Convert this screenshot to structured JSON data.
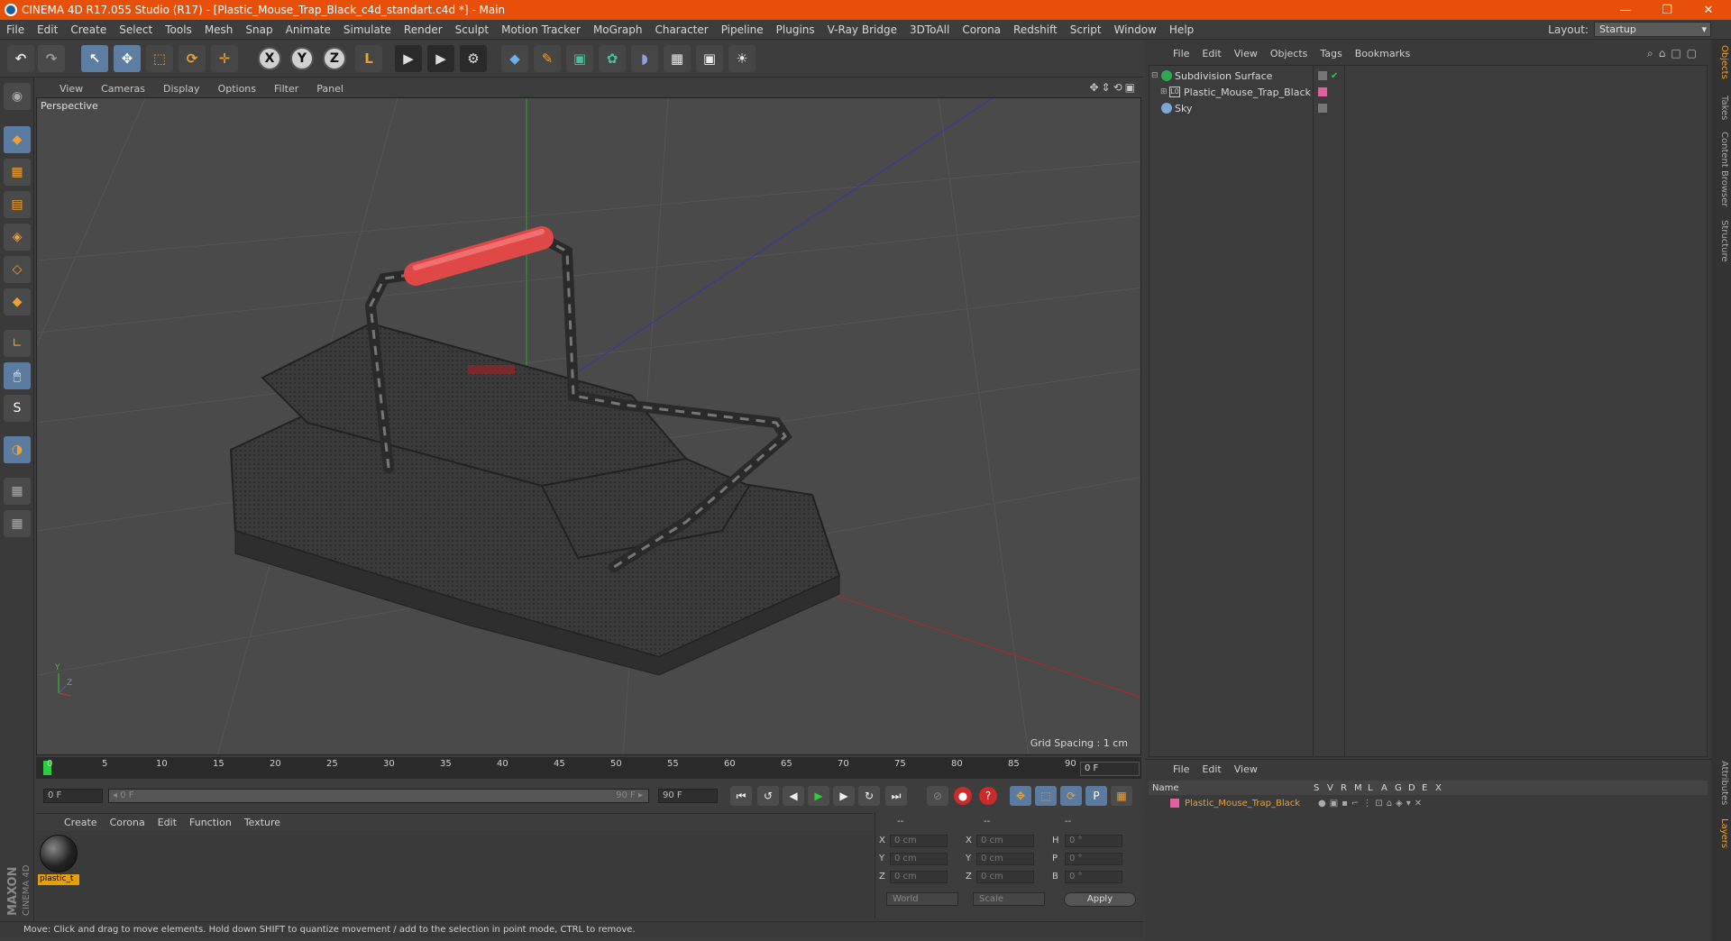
{
  "titlebar": {
    "text": "CINEMA 4D R17.055 Studio (R17) - [Plastic_Mouse_Trap_Black_c4d_standart.c4d *] - Main",
    "min": "—",
    "restore": "❐",
    "close": "✕"
  },
  "menubar": [
    "File",
    "Edit",
    "Create",
    "Select",
    "Tools",
    "Mesh",
    "Snap",
    "Animate",
    "Simulate",
    "Render",
    "Sculpt",
    "Motion Tracker",
    "MoGraph",
    "Character",
    "Pipeline",
    "Plugins",
    "V-Ray Bridge",
    "3DToAll",
    "Corona",
    "Redshift",
    "Script",
    "Window",
    "Help"
  ],
  "layout": {
    "label": "Layout:",
    "value": "Startup"
  },
  "toolbar": {
    "undo": "↶",
    "redo": "↷",
    "select": "↖",
    "move": "✥",
    "scale": "⬚",
    "rotate": "⟳",
    "add": "✛",
    "x": "X",
    "y": "Y",
    "z": "Z",
    "world": "L"
  },
  "viewport": {
    "menu": [
      "View",
      "Cameras",
      "Display",
      "Options",
      "Filter",
      "Panel"
    ],
    "nav_icons": "✥⇕⟲▣",
    "label": "Perspective",
    "grid_spacing": "Grid Spacing : 1 cm"
  },
  "objects": {
    "menu": [
      "File",
      "Edit",
      "View",
      "Objects",
      "Tags",
      "Bookmarks"
    ],
    "items": [
      {
        "name": "Subdivision Surface",
        "icon_color": "#2fa84f"
      },
      {
        "name": "Plastic_Mouse_Trap_Black",
        "icon_color": "#8a8a8a",
        "tag_color": "#e060a0"
      },
      {
        "name": "Sky",
        "icon_color": "#7aa7d6"
      }
    ]
  },
  "side_tabs": [
    "Objects",
    "Takes",
    "Content Browser",
    "Structure",
    "Attributes",
    "Layers"
  ],
  "layers": {
    "menu": [
      "File",
      "Edit",
      "View"
    ],
    "headers": [
      "Name",
      "S",
      "V",
      "R",
      "M",
      "L",
      "A",
      "G",
      "D",
      "E",
      "X"
    ],
    "row_name": "Plastic_Mouse_Trap_Black",
    "row_color": "#e060a0"
  },
  "timeline": {
    "ticks": [
      "0",
      "5",
      "10",
      "15",
      "20",
      "25",
      "30",
      "35",
      "40",
      "45",
      "50",
      "55",
      "60",
      "65",
      "70",
      "75",
      "80",
      "85",
      "90"
    ],
    "frame": "0 F"
  },
  "controls": {
    "start_field": "0 F",
    "range_start": "◂ 0 F",
    "range_end": "90 F ▸",
    "end_field": "90 F"
  },
  "materials": {
    "menu": [
      "Create",
      "Corona",
      "Edit",
      "Function",
      "Texture"
    ],
    "item": "plastic_t"
  },
  "coords": {
    "headers": [
      "--",
      "--",
      "--"
    ],
    "rows": [
      {
        "a": "X",
        "av": "0 cm",
        "b": "X",
        "bv": "0 cm",
        "c": "H",
        "cv": "0 °"
      },
      {
        "a": "Y",
        "av": "0 cm",
        "b": "Y",
        "bv": "0 cm",
        "c": "P",
        "cv": "0 °"
      },
      {
        "a": "Z",
        "av": "0 cm",
        "b": "Z",
        "bv": "0 cm",
        "c": "B",
        "cv": "0 °"
      }
    ],
    "world": "World",
    "scale": "Scale",
    "apply": "Apply"
  },
  "status": "Move: Click and drag to move elements. Hold down SHIFT to quantize movement / add to the selection in point mode, CTRL to remove.",
  "brand": {
    "line1": "MAXON",
    "line2": "CINEMA 4D"
  },
  "colors": {
    "titlebar": "#e8500a",
    "accent_blue": "#5b7ca0",
    "handle_red": "#e04848"
  }
}
